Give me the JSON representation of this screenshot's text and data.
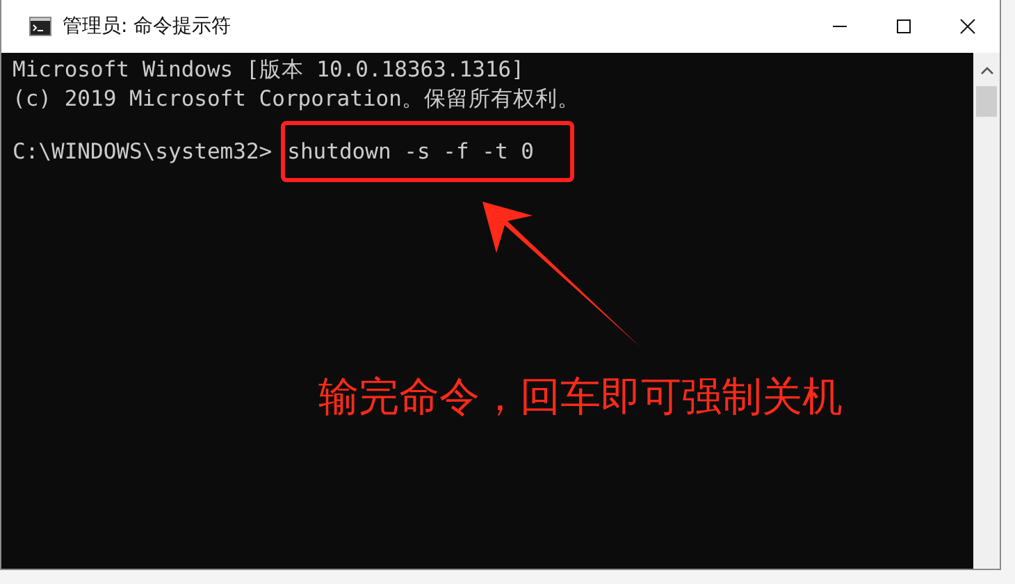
{
  "window": {
    "title": "管理员: 命令提示符"
  },
  "console": {
    "lines": [
      {
        "kind": "output",
        "text": "Microsoft Windows [版本 10.0.18363.1316]"
      },
      {
        "kind": "output",
        "text": "(c) 2019 Microsoft Corporation。保留所有权利。"
      },
      {
        "kind": "blank"
      },
      {
        "kind": "prompt",
        "prompt": "C:\\WINDOWS\\system32>",
        "command": "shutdown -s -f -t 0"
      }
    ]
  },
  "annotation": {
    "text": "输完命令，回车即可强制关机"
  }
}
